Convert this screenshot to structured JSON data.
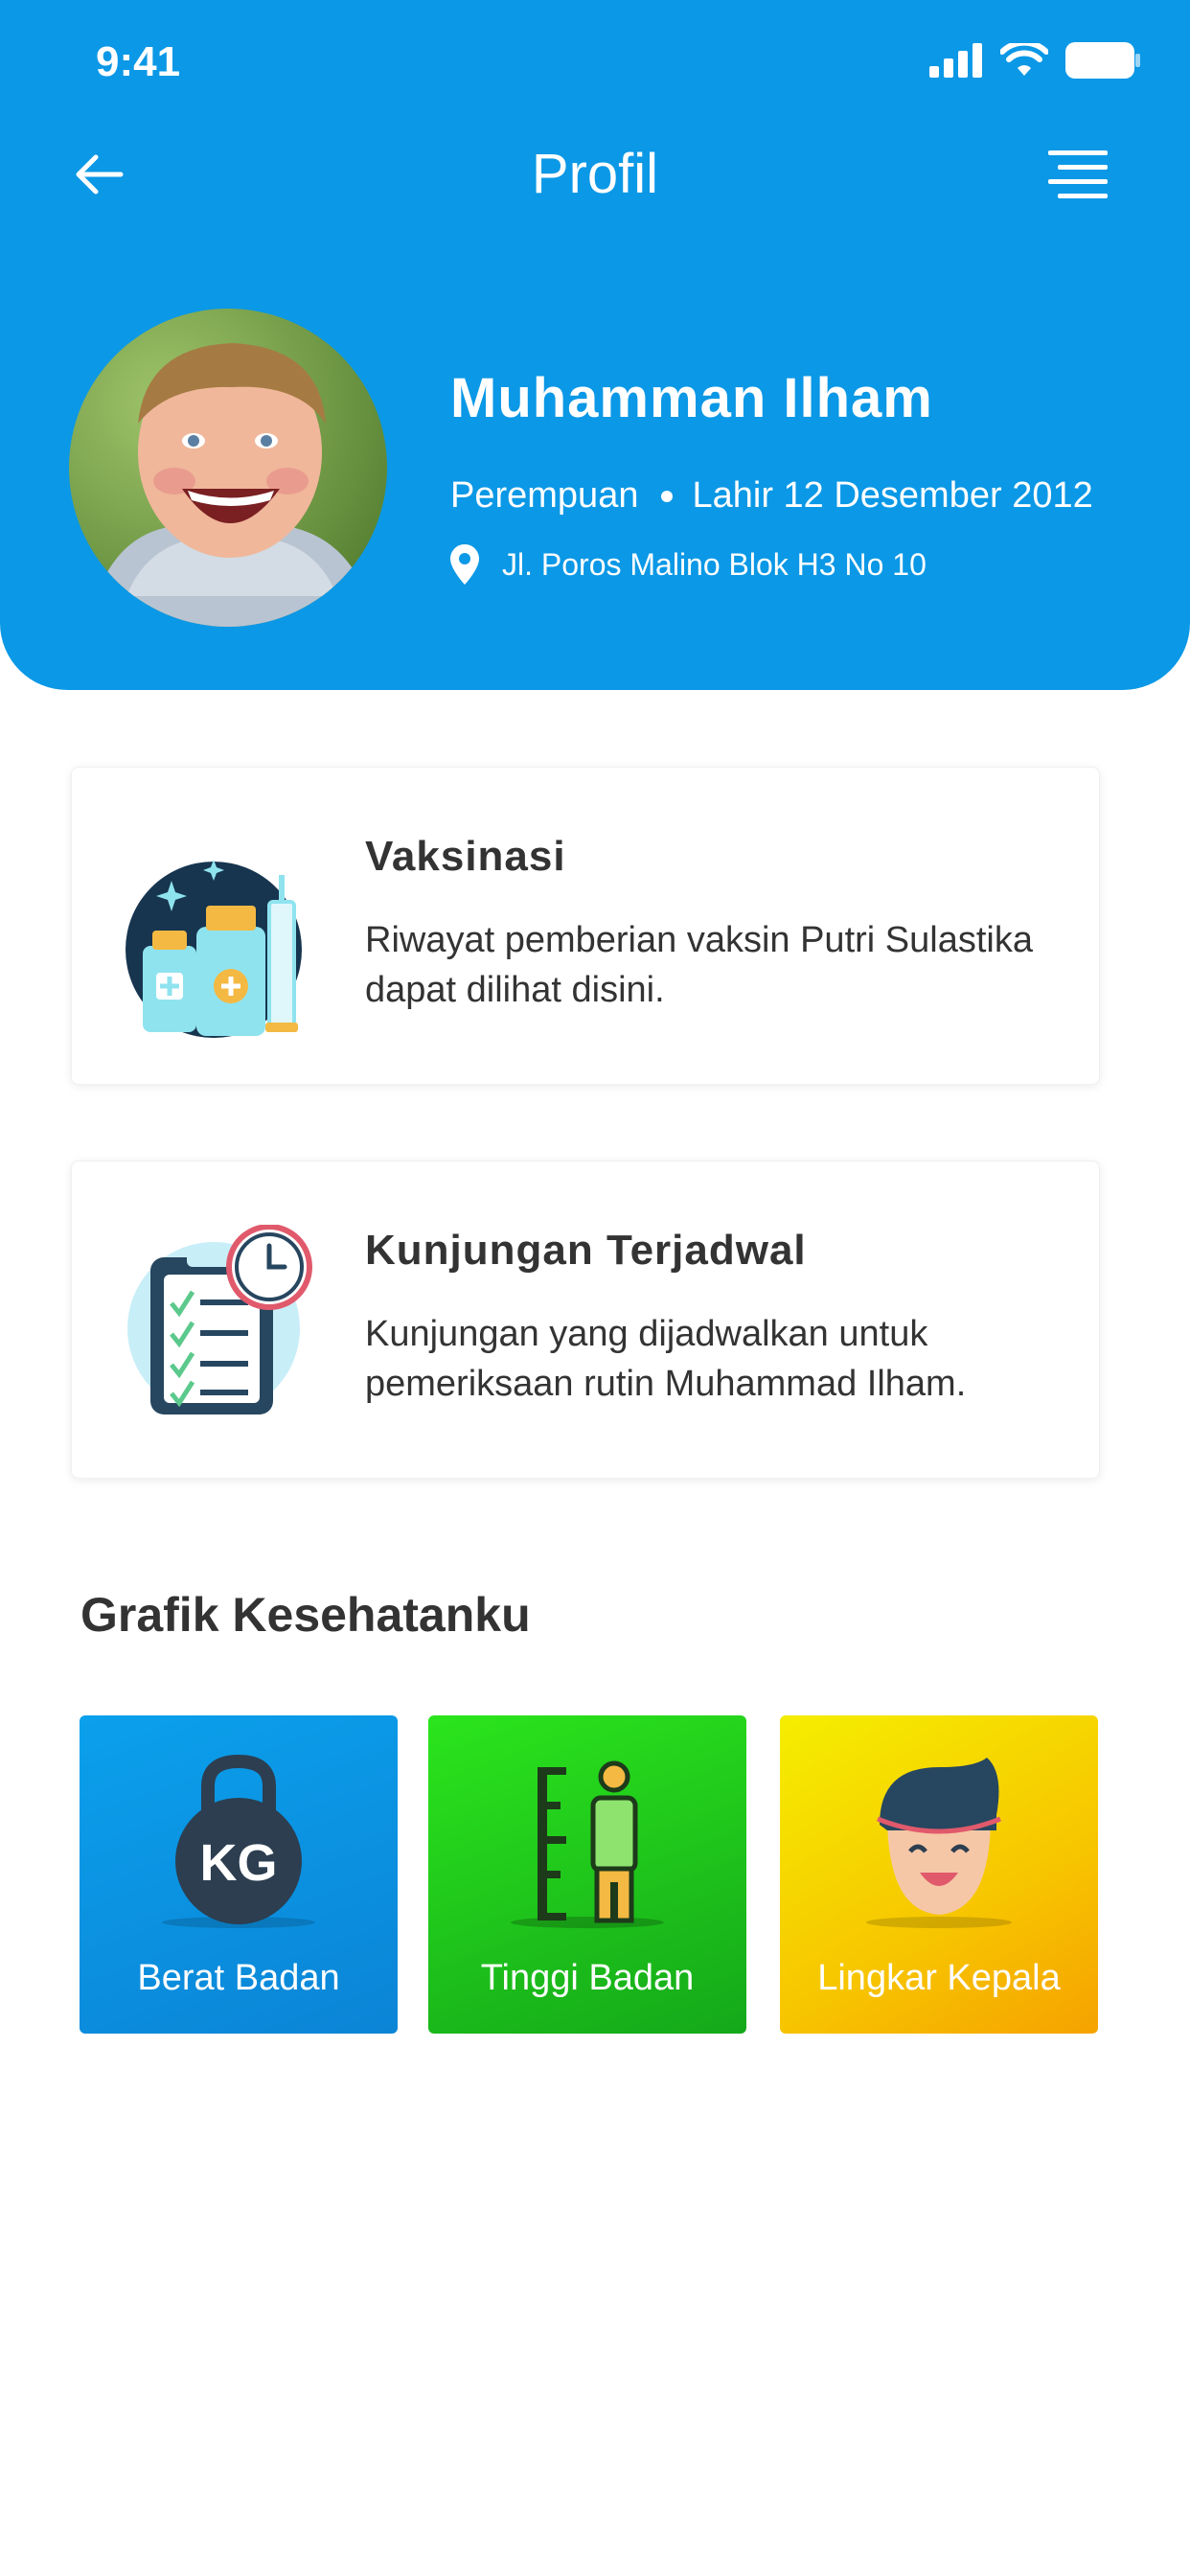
{
  "status": {
    "time": "9:41"
  },
  "header": {
    "title": "Profil"
  },
  "profile": {
    "name": "Muhamman Ilham",
    "gender": "Perempuan",
    "birth": "Lahir 12 Desember 2012",
    "address": "Jl. Poros Malino Blok H3 No 10"
  },
  "cards": [
    {
      "title": "Vaksinasi",
      "description": "Riwayat pemberian vaksin Putri Sulastika dapat dilihat disini.",
      "icon": "vaccine-icon"
    },
    {
      "title": "Kunjungan Terjadwal",
      "description": "Kunjungan yang dijadwalkan untuk pemeriksaan rutin Muhammad Ilham.",
      "icon": "schedule-clipboard-icon"
    }
  ],
  "section": {
    "title": "Grafik Kesehatanku"
  },
  "tiles": [
    {
      "label": "Berat Badan",
      "icon": "weight-kg-icon",
      "color": "#0b98e6"
    },
    {
      "label": "Tinggi Badan",
      "icon": "height-ruler-icon",
      "color": "#1fc41a"
    },
    {
      "label": "Lingkar Kepala",
      "icon": "head-circumference-icon",
      "color": "#f7c600"
    }
  ],
  "colors": {
    "primary": "#0b98e6"
  }
}
